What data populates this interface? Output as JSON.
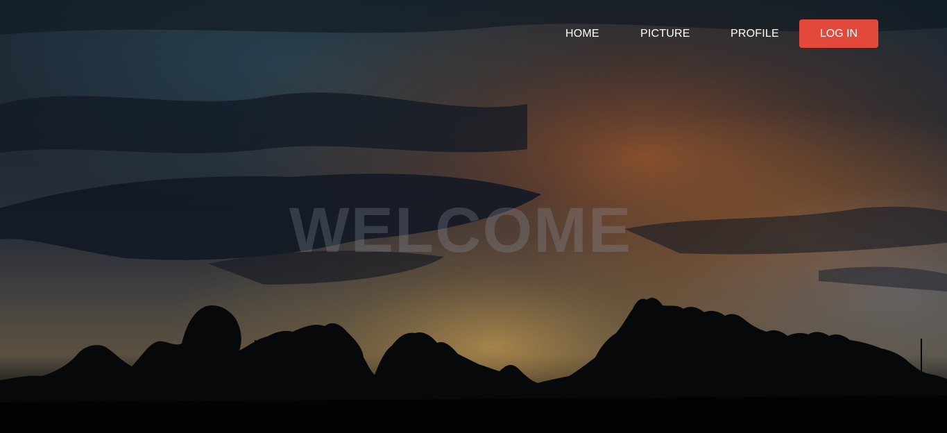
{
  "nav": {
    "items": [
      {
        "label": "HOME"
      },
      {
        "label": "PICTURE"
      },
      {
        "label": "PROFILE"
      }
    ],
    "login_label": "LOG IN"
  },
  "hero": {
    "heading": "WELCOME",
    "background_image": "sunset-sky-with-tree-silhouettes"
  },
  "colors": {
    "accent": "#e2493a",
    "nav_text": "#ffffff",
    "heading_text": "#6b7280"
  }
}
